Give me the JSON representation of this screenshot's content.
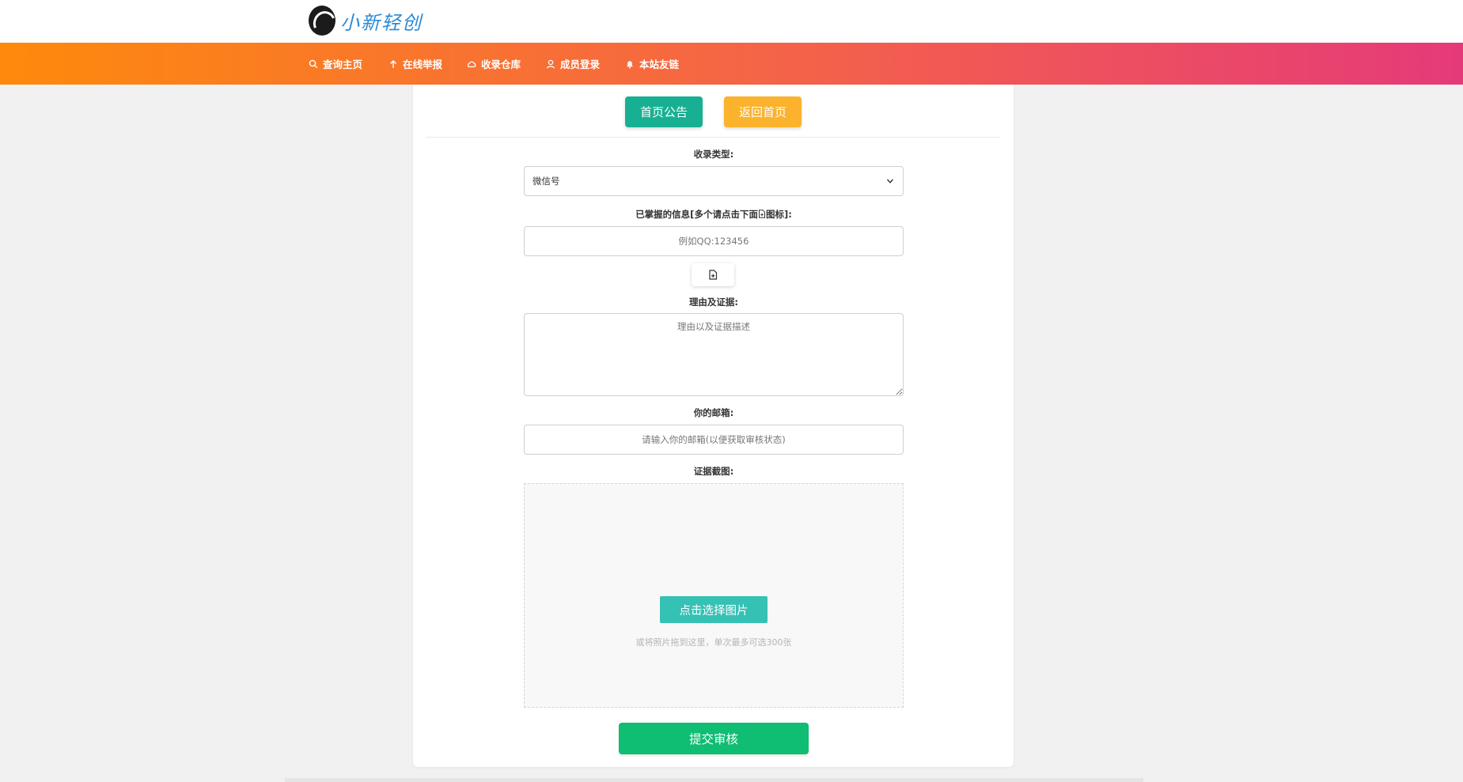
{
  "brand": {
    "name": "小新轻创"
  },
  "nav": [
    {
      "label": "查询主页",
      "icon": "search-icon"
    },
    {
      "label": "在线举报",
      "icon": "arrow-up-icon"
    },
    {
      "label": "收录仓库",
      "icon": "cloud-icon"
    },
    {
      "label": "成员登录",
      "icon": "user-icon"
    },
    {
      "label": "本站友链",
      "icon": "bell-icon"
    }
  ],
  "actions": {
    "announcement": "首页公告",
    "back_home": "返回首页"
  },
  "form": {
    "type_label": "收录类型:",
    "type_value": "微信号",
    "info_label_prefix": "已掌握的信息[多个请点击下面",
    "info_label_suffix": "图标]:",
    "info_placeholder": "例如QQ:123456",
    "reason_label": "理由及证据:",
    "reason_placeholder": "理由以及证据描述",
    "email_label": "你的邮箱:",
    "email_placeholder": "请输入你的邮箱(以便获取审核状态)",
    "screenshot_label": "证据截图:",
    "upload_button": "点击选择图片",
    "upload_hint": "或将照片拖到这里，单次最多可选300张",
    "submit": "提交审核"
  },
  "colors": {
    "nav_gradient": [
      "#fe8a0c",
      "#f4624a",
      "#e53a79"
    ],
    "teal": "#17b092",
    "orange": "#fbb22c",
    "upload_teal": "#36c1b5",
    "submit_green": "#0fbd73",
    "brand_blue": "#2a8ad6"
  }
}
